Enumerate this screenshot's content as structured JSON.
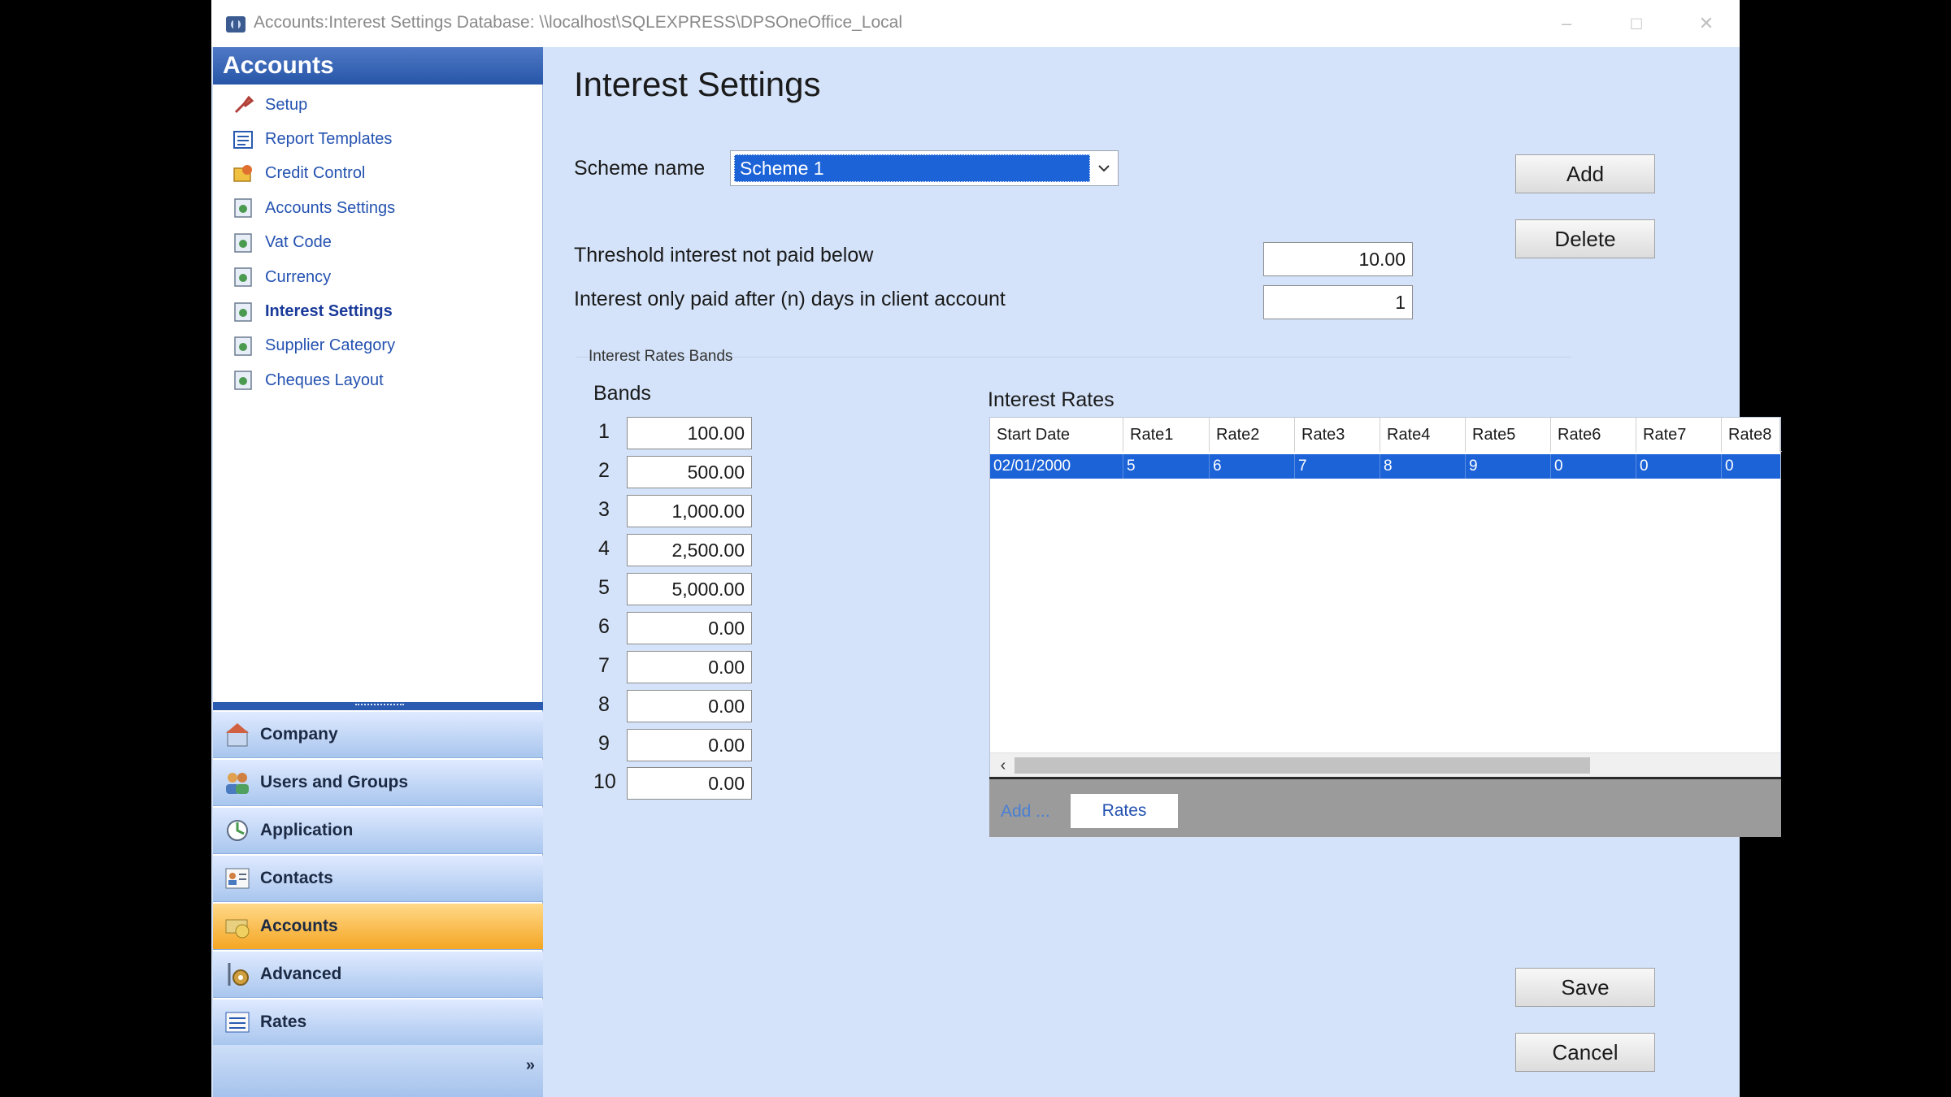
{
  "window": {
    "title": "Accounts:Interest Settings Database: \\\\localhost\\SQLEXPRESS\\DPSOneOffice_Local",
    "icon": "app-database-icon"
  },
  "sidebar": {
    "header": "Accounts",
    "items": [
      {
        "label": "Setup",
        "icon": "wrench-icon"
      },
      {
        "label": "Report Templates",
        "icon": "report-icon"
      },
      {
        "label": "Credit Control",
        "icon": "credit-control-icon"
      },
      {
        "label": "Accounts Settings",
        "icon": "settings-doc-icon"
      },
      {
        "label": "Vat Code",
        "icon": "settings-doc-icon"
      },
      {
        "label": "Currency",
        "icon": "settings-doc-icon"
      },
      {
        "label": "Interest Settings",
        "icon": "settings-doc-icon",
        "active": true
      },
      {
        "label": "Supplier Category",
        "icon": "settings-doc-icon"
      },
      {
        "label": "Cheques Layout",
        "icon": "settings-doc-icon"
      }
    ],
    "modules": [
      {
        "label": "Company",
        "icon": "company-icon"
      },
      {
        "label": "Users and Groups",
        "icon": "users-icon"
      },
      {
        "label": "Application",
        "icon": "application-icon"
      },
      {
        "label": "Contacts",
        "icon": "contacts-icon"
      },
      {
        "label": "Accounts",
        "icon": "accounts-icon",
        "active": true
      },
      {
        "label": "Advanced",
        "icon": "advanced-icon"
      },
      {
        "label": "Rates",
        "icon": "rates-icon"
      }
    ]
  },
  "main": {
    "title": "Interest Settings",
    "scheme": {
      "label": "Scheme name",
      "value": "Scheme 1"
    },
    "threshold": {
      "label": "Threshold interest not paid below",
      "value": "10.00"
    },
    "days": {
      "label": "Interest only paid after (n) days in client account",
      "value": "1"
    },
    "buttons": {
      "add": "Add",
      "delete": "Delete",
      "save": "Save",
      "cancel": "Cancel"
    },
    "group_label": "Interest Rates Bands",
    "bands": {
      "label": "Bands",
      "rows": [
        {
          "num": "1",
          "value": "100.00"
        },
        {
          "num": "2",
          "value": "500.00"
        },
        {
          "num": "3",
          "value": "1,000.00"
        },
        {
          "num": "4",
          "value": "2,500.00"
        },
        {
          "num": "5",
          "value": "5,000.00"
        },
        {
          "num": "6",
          "value": "0.00"
        },
        {
          "num": "7",
          "value": "0.00"
        },
        {
          "num": "8",
          "value": "0.00"
        },
        {
          "num": "9",
          "value": "0.00"
        },
        {
          "num": "10",
          "value": "0.00"
        }
      ]
    },
    "rates": {
      "label": "Interest Rates",
      "columns": [
        "Start Date",
        "Rate1",
        "Rate2",
        "Rate3",
        "Rate4",
        "Rate5",
        "Rate6",
        "Rate7",
        "Rate8"
      ],
      "rows": [
        [
          "02/01/2000",
          "5",
          "6",
          "7",
          "8",
          "9",
          "0",
          "0",
          "0"
        ]
      ],
      "footer_add": "Add ...",
      "footer_tab": "Rates"
    }
  },
  "colors": {
    "selection": "#1c63d8",
    "accent_module": "#f5a623",
    "sidebar_header": "#2756a8",
    "background": "#d4e3f9"
  }
}
